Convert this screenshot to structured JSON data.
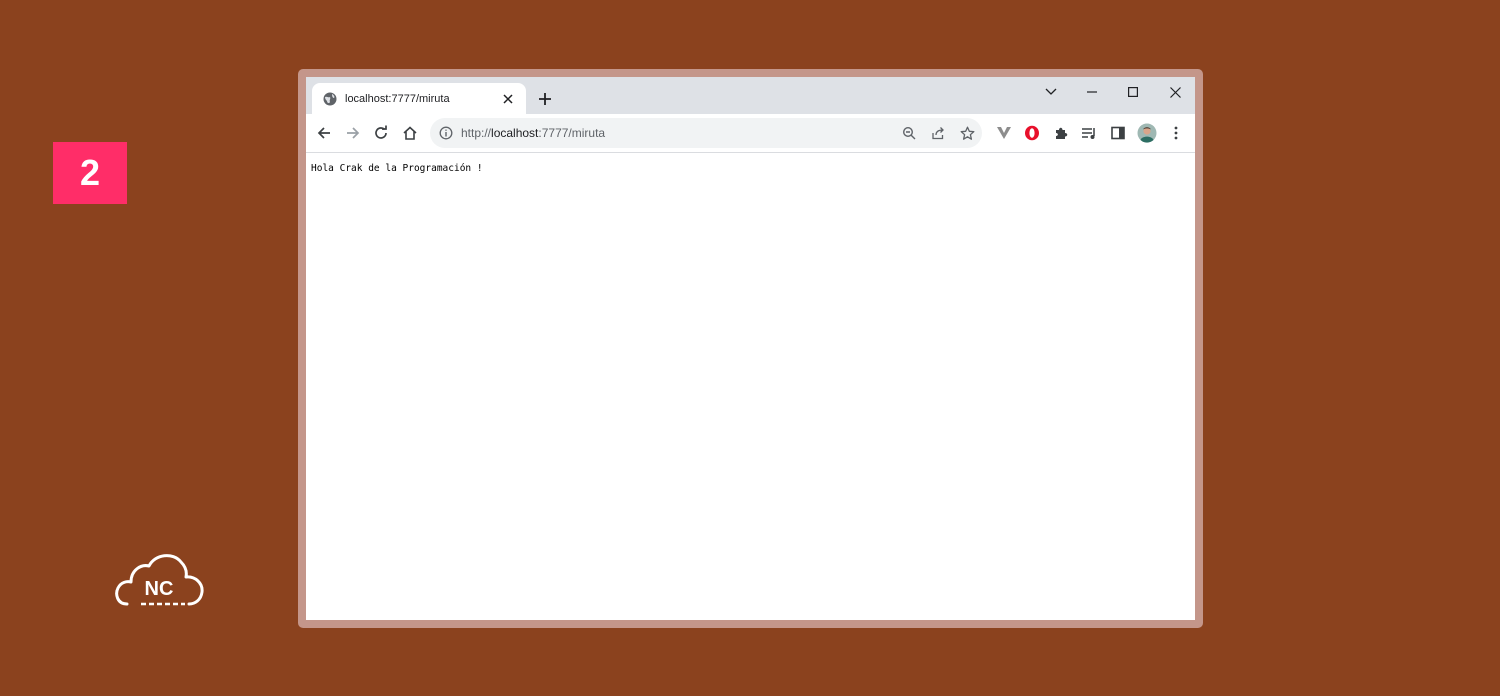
{
  "step_badge": {
    "number": "2",
    "color": "#ff2d68"
  },
  "logo": {
    "text": "NC",
    "icon": "cloud-logo"
  },
  "browser": {
    "tab": {
      "title": "localhost:7777/miruta",
      "icon": "globe-icon"
    },
    "address_bar": {
      "url_prefix": "http://",
      "url_host": "localhost",
      "url_rest": ":7777/miruta"
    },
    "toolbar_icons": [
      "back-icon",
      "forward-icon",
      "reload-icon",
      "home-icon",
      "info-icon",
      "zoom-icon",
      "share-icon",
      "bookmark-star-icon",
      "vivaldi-extension-icon",
      "opera-extension-icon",
      "extensions-puzzle-icon",
      "reading-list-icon",
      "side-panel-icon",
      "profile-avatar",
      "more-menu-icon"
    ],
    "window_controls": [
      "tab-search-icon",
      "minimize-icon",
      "maximize-icon",
      "close-window-icon"
    ]
  },
  "page": {
    "body_text": "Hola Crak de la Programación !"
  },
  "colors": {
    "background": "#8b421e",
    "frame": "#c4968a",
    "tabstrip": "#dee1e6"
  }
}
